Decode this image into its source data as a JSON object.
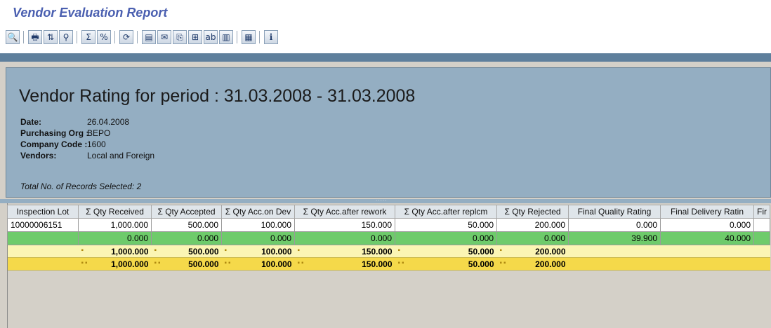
{
  "app": {
    "title": "Vendor Evaluation Report"
  },
  "toolbar": {
    "buttons": [
      {
        "icon": "magnifier-details-icon",
        "glyph": "🔍"
      },
      {
        "icon": "print-icon",
        "glyph": "🖶"
      },
      {
        "icon": "sort-ascending-icon",
        "glyph": "⇅"
      },
      {
        "icon": "filter-icon",
        "glyph": "⚲"
      },
      {
        "icon": "sum-icon",
        "glyph": "Σ"
      },
      {
        "icon": "subtotal-icon",
        "glyph": "%"
      },
      {
        "icon": "refresh-icon",
        "glyph": "⟳"
      },
      {
        "icon": "export-icon",
        "glyph": "▤"
      },
      {
        "icon": "mail-icon",
        "glyph": "✉"
      },
      {
        "icon": "save-local-icon",
        "glyph": "⎘"
      },
      {
        "icon": "spreadsheet-icon",
        "glyph": "⊞"
      },
      {
        "icon": "word-processing-icon",
        "glyph": "ab"
      },
      {
        "icon": "graphic-icon",
        "glyph": "▥"
      },
      {
        "icon": "layout-icon",
        "glyph": "▦"
      },
      {
        "icon": "info-icon",
        "glyph": "i"
      }
    ]
  },
  "report": {
    "heading": "Vendor Rating for period : 31.03.2008 - 31.03.2008",
    "info": [
      {
        "label": "Date:",
        "value": "26.04.2008"
      },
      {
        "label": "Purchasing Org :",
        "value": "BEPO"
      },
      {
        "label": "Company Code :",
        "value": "1600"
      },
      {
        "label": "Vendors:",
        "value": "Local and Foreign"
      }
    ],
    "total_records": "Total No. of Records Selected: 2"
  },
  "grid": {
    "columns": [
      "Inspection Lot",
      "Σ Qty Received",
      "Σ Qty Accepted",
      "Σ Qty Acc.on Dev",
      "Σ Qty Acc.after rework",
      "Σ Qty Acc.after replcm",
      "Σ Qty Rejected",
      "Final Quality Rating",
      "Final Delivery Ratin",
      "Fir"
    ],
    "row1": [
      "10000006151",
      "1,000.000",
      "500.000",
      "100.000",
      "150.000",
      "50.000",
      "200.000",
      "0.000",
      "0.000",
      ""
    ],
    "row2": [
      "",
      "0.000",
      "0.000",
      "0.000",
      "0.000",
      "0.000",
      "0.000",
      "39.900",
      "40.000",
      ""
    ],
    "subtotal": [
      "",
      "1,000.000",
      "500.000",
      "100.000",
      "150.000",
      "50.000",
      "200.000",
      "",
      "",
      ""
    ],
    "total": [
      "",
      "1,000.000",
      "500.000",
      "100.000",
      "150.000",
      "50.000",
      "200.000",
      "",
      "",
      ""
    ],
    "sub_marker": "▪",
    "total_marker": "▪▪"
  },
  "colors": {
    "title": "#4a5fb0",
    "header_panel": "#94aec2",
    "green_row": "#6ecb6b",
    "subtotal_row": "#fbf5b4",
    "total_row": "#f5d94a"
  }
}
